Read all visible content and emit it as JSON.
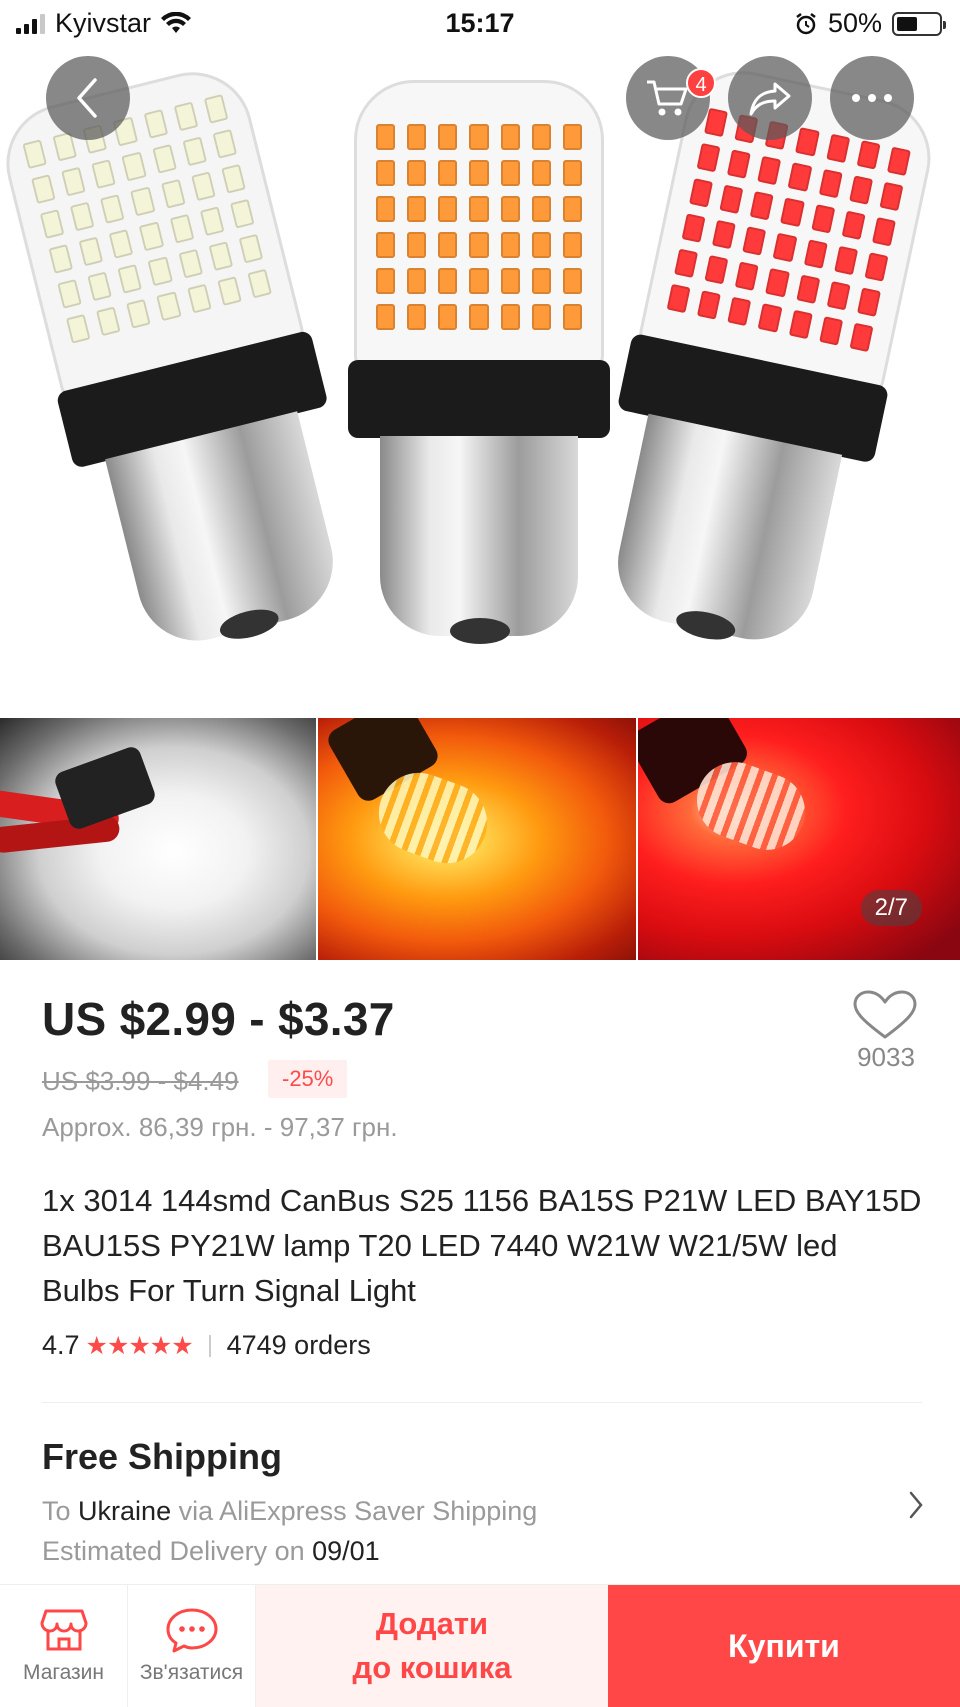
{
  "status_bar": {
    "carrier": "Kyivstar",
    "time": "15:17",
    "battery": "50%"
  },
  "header": {
    "cart_count": "4"
  },
  "gallery": {
    "page_indicator": "2/7"
  },
  "product": {
    "price": "US $2.99 - $3.37",
    "old_price": "US $3.99 - $4.49",
    "discount": "-25%",
    "approx_price": "Approx. 86,39 грн. - 97,37 грн.",
    "wishlist_count": "9033",
    "title": "1x 3014 144smd CanBus S25 1156 BA15S P21W LED BAY15D BAU15S PY21W lamp T20 LED 7440 W21W W21/5W led Bulbs For Turn Signal Light",
    "rating": "4.7",
    "stars": "★★★★★",
    "orders": "4749 orders"
  },
  "shipping": {
    "title": "Free Shipping",
    "to_label": "To",
    "destination": "Ukraine",
    "via": "via AliExpress Saver Shipping",
    "estimated_label": "Estimated Delivery on",
    "estimated_date": "09/01"
  },
  "bottom_bar": {
    "store_label": "Магазин",
    "contact_label": "Зв'язатися",
    "add_to_cart_line1": "Додати",
    "add_to_cart_line2": "до кошика",
    "buy_label": "Купити"
  },
  "colors": {
    "accent": "#ff4747",
    "led_white": "#f4f4d8",
    "led_amber": "#ff9a3a",
    "led_red": "#ff3a3a"
  }
}
